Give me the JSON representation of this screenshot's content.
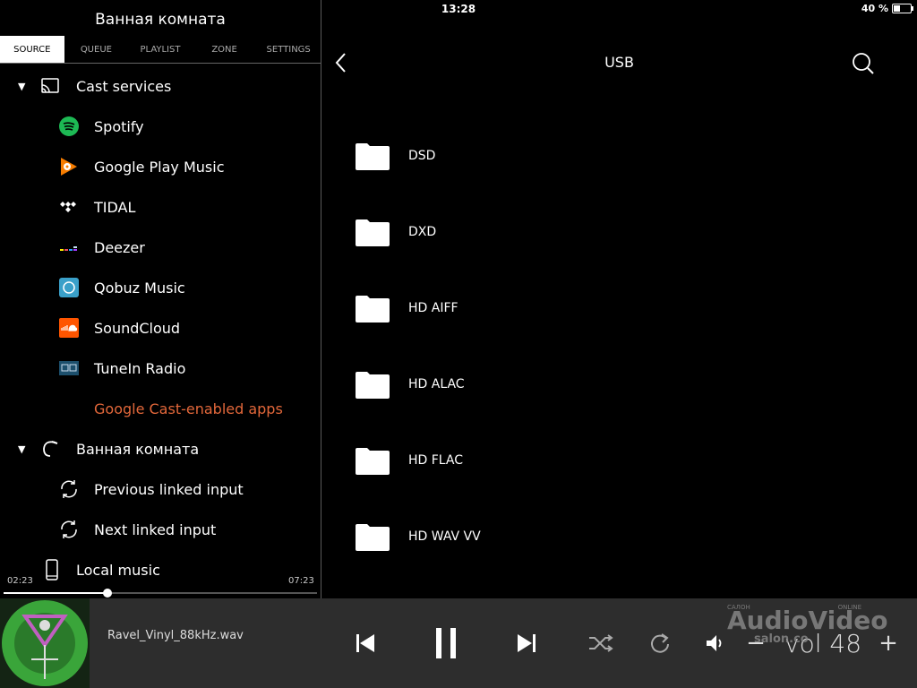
{
  "status": {
    "time": "13:28",
    "battery": "40 %",
    "battery_level": 0.4
  },
  "left": {
    "room_title": "Ванная комната",
    "tabs": [
      "SOURCE",
      "QUEUE",
      "PLAYLIST",
      "ZONE",
      "SETTINGS"
    ],
    "active_tab": "SOURCE",
    "cast_services_label": "Cast services",
    "cast_items": [
      {
        "label": "Spotify",
        "icon": "spotify-icon",
        "color": "#1db954"
      },
      {
        "label": "Google Play Music",
        "icon": "google-play-music-icon",
        "color": "#f57c00"
      },
      {
        "label": "TIDAL",
        "icon": "tidal-icon",
        "color": "#ffffff"
      },
      {
        "label": "Deezer",
        "icon": "deezer-icon",
        "color": "#e84a5f"
      },
      {
        "label": "Qobuz Music",
        "icon": "qobuz-icon",
        "color": "#3aa0c9"
      },
      {
        "label": "SoundCloud",
        "icon": "soundcloud-icon",
        "color": "#ff5500"
      },
      {
        "label": "TuneIn Radio",
        "icon": "tunein-icon",
        "color": "#1c4f6c"
      }
    ],
    "cast_enabled_apps": "Google Cast-enabled apps",
    "room_section_label": "Ванная комната",
    "room_items": [
      "Previous linked input",
      "Next linked input"
    ],
    "local_music": "Local music",
    "elapsed": "02:23",
    "duration": "07:23",
    "progress": 0.33
  },
  "browser": {
    "title": "USB",
    "folders": [
      "DSD",
      "DXD",
      "HD AIFF",
      "HD ALAC",
      "HD FLAC",
      "HD WAV VV"
    ]
  },
  "player": {
    "track": "Ravel_Vinyl_88kHz.wav",
    "volume_text": "vol 48",
    "volume_minus": "−",
    "volume_plus": "+",
    "watermark": "AudioVideo",
    "watermark_small_left": "САЛОН",
    "watermark_small_right": "ONLINE",
    "watermark_domain": "salon.co"
  }
}
